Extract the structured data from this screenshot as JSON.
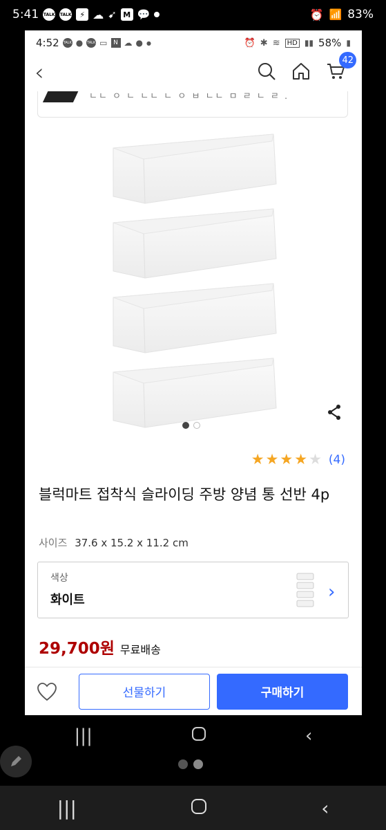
{
  "outer_status": {
    "time": "5:41",
    "battery": "83%",
    "icons": [
      "talk-icon",
      "talk-icon",
      "bolt-icon",
      "cloud-icon",
      "cursor-icon",
      "m-icon",
      "chat-icon",
      "dot-icon"
    ]
  },
  "inner_status": {
    "time": "4:52",
    "battery": "58%",
    "network": "HD"
  },
  "appbar": {
    "cart_count": "42"
  },
  "banner": {
    "cutoff_text": "ㄴㄴ ㅇ ㄴ ㄴㄴ ㄴ ㅇ ㅂ ㄴㄴ ㅁ ㄹ ㄴ ㄹ ."
  },
  "gallery": {
    "page_count": 2,
    "current_page": 1
  },
  "rating": {
    "stars": 4,
    "max": 5,
    "count_label": "(4)"
  },
  "product": {
    "title": "블럭마트 접착식 슬라이딩 주방 양념 통 선반 4p",
    "spec_label": "사이즈",
    "spec_value": "37.6 x 15.2 x 11.2 cm"
  },
  "option": {
    "label": "색상",
    "value": "화이트"
  },
  "price": {
    "amount": "29,700원",
    "shipping": "무료배송"
  },
  "actions": {
    "gift_label": "선물하기",
    "buy_label": "구매하기"
  },
  "colors": {
    "accent": "#346aff",
    "price": "#ae0000",
    "star": "#f5a623"
  }
}
